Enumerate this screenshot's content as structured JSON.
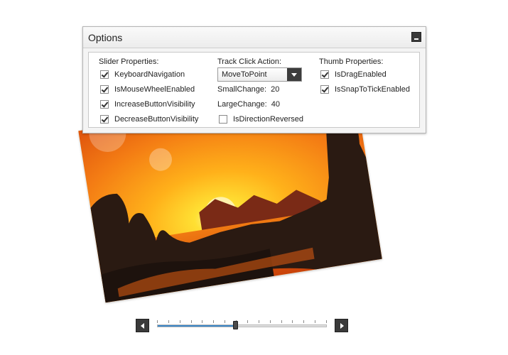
{
  "options": {
    "title": "Options",
    "slider_properties": {
      "label": "Slider Properties:",
      "items": [
        {
          "label": "KeyboardNavigation",
          "checked": true
        },
        {
          "label": "IsMouseWheelEnabled",
          "checked": true
        },
        {
          "label": "IncreaseButtonVisibility",
          "checked": true
        },
        {
          "label": "DecreaseButtonVisibility",
          "checked": true
        }
      ]
    },
    "track_click_action": {
      "label": "Track Click Action:",
      "selected": "MoveToPoint",
      "small_change_label": "SmallChange:",
      "small_change_value": "20",
      "large_change_label": "LargeChange:",
      "large_change_value": "40",
      "is_direction_reversed": {
        "label": "IsDirectionReversed",
        "checked": false
      }
    },
    "thumb_properties": {
      "label": "Thumb Properties:",
      "items": [
        {
          "label": "IsDragEnabled",
          "checked": true
        },
        {
          "label": "IsSnapToTickEnabled",
          "checked": true
        }
      ]
    }
  },
  "slider": {
    "value_fraction": 0.46,
    "tick_count": 16
  },
  "colors": {
    "accent": "#3b86c6",
    "dark_button": "#3a3a3a",
    "sunset_orange": "#f39018",
    "silhouette": "#2a1a12"
  }
}
